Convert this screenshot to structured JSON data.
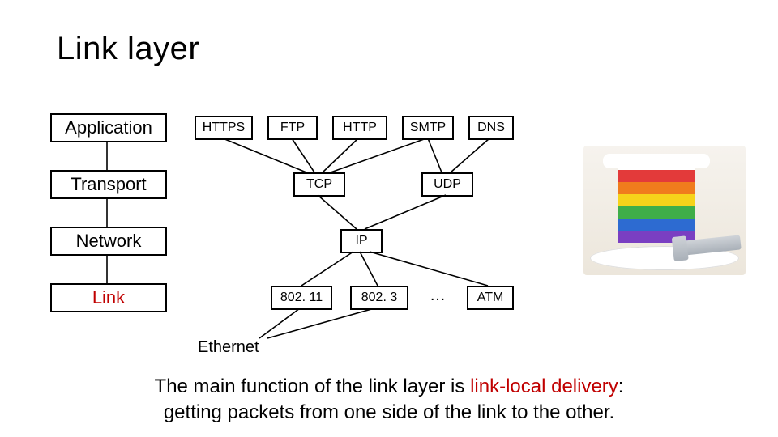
{
  "title": "Link layer",
  "layers": {
    "application": "Application",
    "transport": "Transport",
    "network": "Network",
    "link": "Link"
  },
  "app_protocols": {
    "https": "HTTPS",
    "ftp": "FTP",
    "http": "HTTP",
    "smtp": "SMTP",
    "dns": "DNS"
  },
  "transport_protocols": {
    "tcp": "TCP",
    "udp": "UDP"
  },
  "network_protocols": {
    "ip": "IP"
  },
  "link_protocols": {
    "w11": "802. 11",
    "w3": "802. 3",
    "atm": "ATM",
    "ellipsis": "…"
  },
  "ethernet_label": "Ethernet",
  "caption_pre": "The main function of the link layer is ",
  "caption_hl": "link-local delivery",
  "caption_post": ":\ngetting packets from one side of the link to the other.",
  "image_alt": "slice of rainbow layer cake on a plate with a fork"
}
